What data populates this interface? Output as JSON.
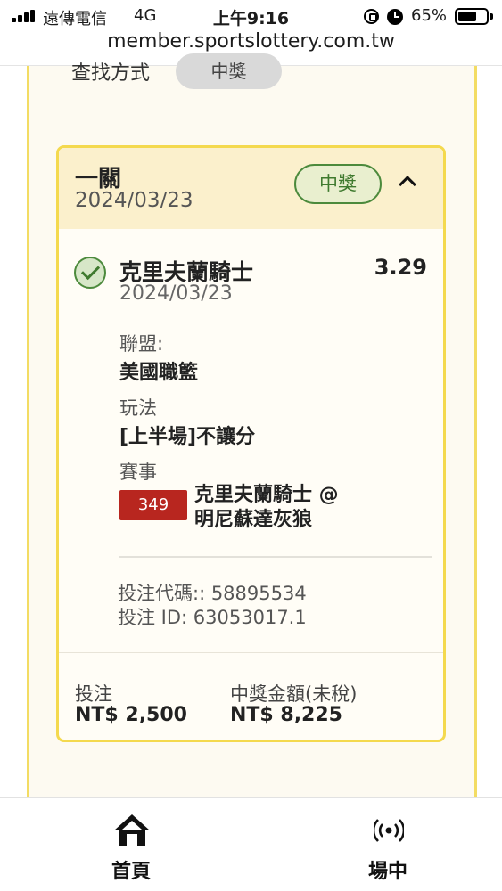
{
  "status_bar": {
    "carrier": "遠傳電信",
    "network": "4G",
    "time": "上午9:16",
    "battery_percent": "65%",
    "battery_level": 0.65
  },
  "browser": {
    "url": "member.sportslottery.com.tw"
  },
  "filter": {
    "label": "查找方式",
    "chip": "中獎"
  },
  "bet": {
    "title": "一關",
    "date": "2024/03/23",
    "status": "中獎",
    "selection": {
      "name": "克里夫蘭騎士",
      "odds": "3.29",
      "date": "2024/03/23"
    },
    "league_label": "聯盟:",
    "league": "美國職籃",
    "play_label": "玩法",
    "play": "[上半場]不讓分",
    "event_label": "賽事",
    "event_number": "349",
    "event_line1": "克里夫蘭騎士 @",
    "event_line2": "明尼蘇達灰狼",
    "bet_code": "投注代碼:: 58895534",
    "bet_id": "投注 ID: 63053017.1",
    "stake_label": "投注",
    "stake": "NT$ 2,500",
    "payout_label": "中獎金額(未稅)",
    "payout": "NT$ 8,225"
  },
  "bottom_nav": {
    "home": "首頁",
    "live": "場中"
  },
  "colors": {
    "accent_yellow": "#f4d94e",
    "win_green": "#3f7a2f",
    "event_red": "#b8261f"
  }
}
